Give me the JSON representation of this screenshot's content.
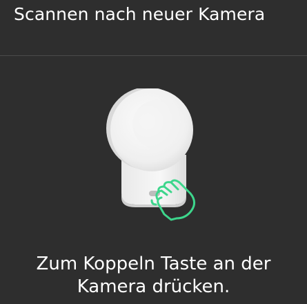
{
  "header": {
    "title": "Scannen nach neuer Kamera"
  },
  "illustration": {
    "icon": "camera-pairing-illustration",
    "hand_icon": "pointing-hand-icon",
    "accent_color": "#3dd68c"
  },
  "instruction": {
    "line1": "Zum Koppeln Taste an der",
    "line2": "Kamera drücken."
  }
}
